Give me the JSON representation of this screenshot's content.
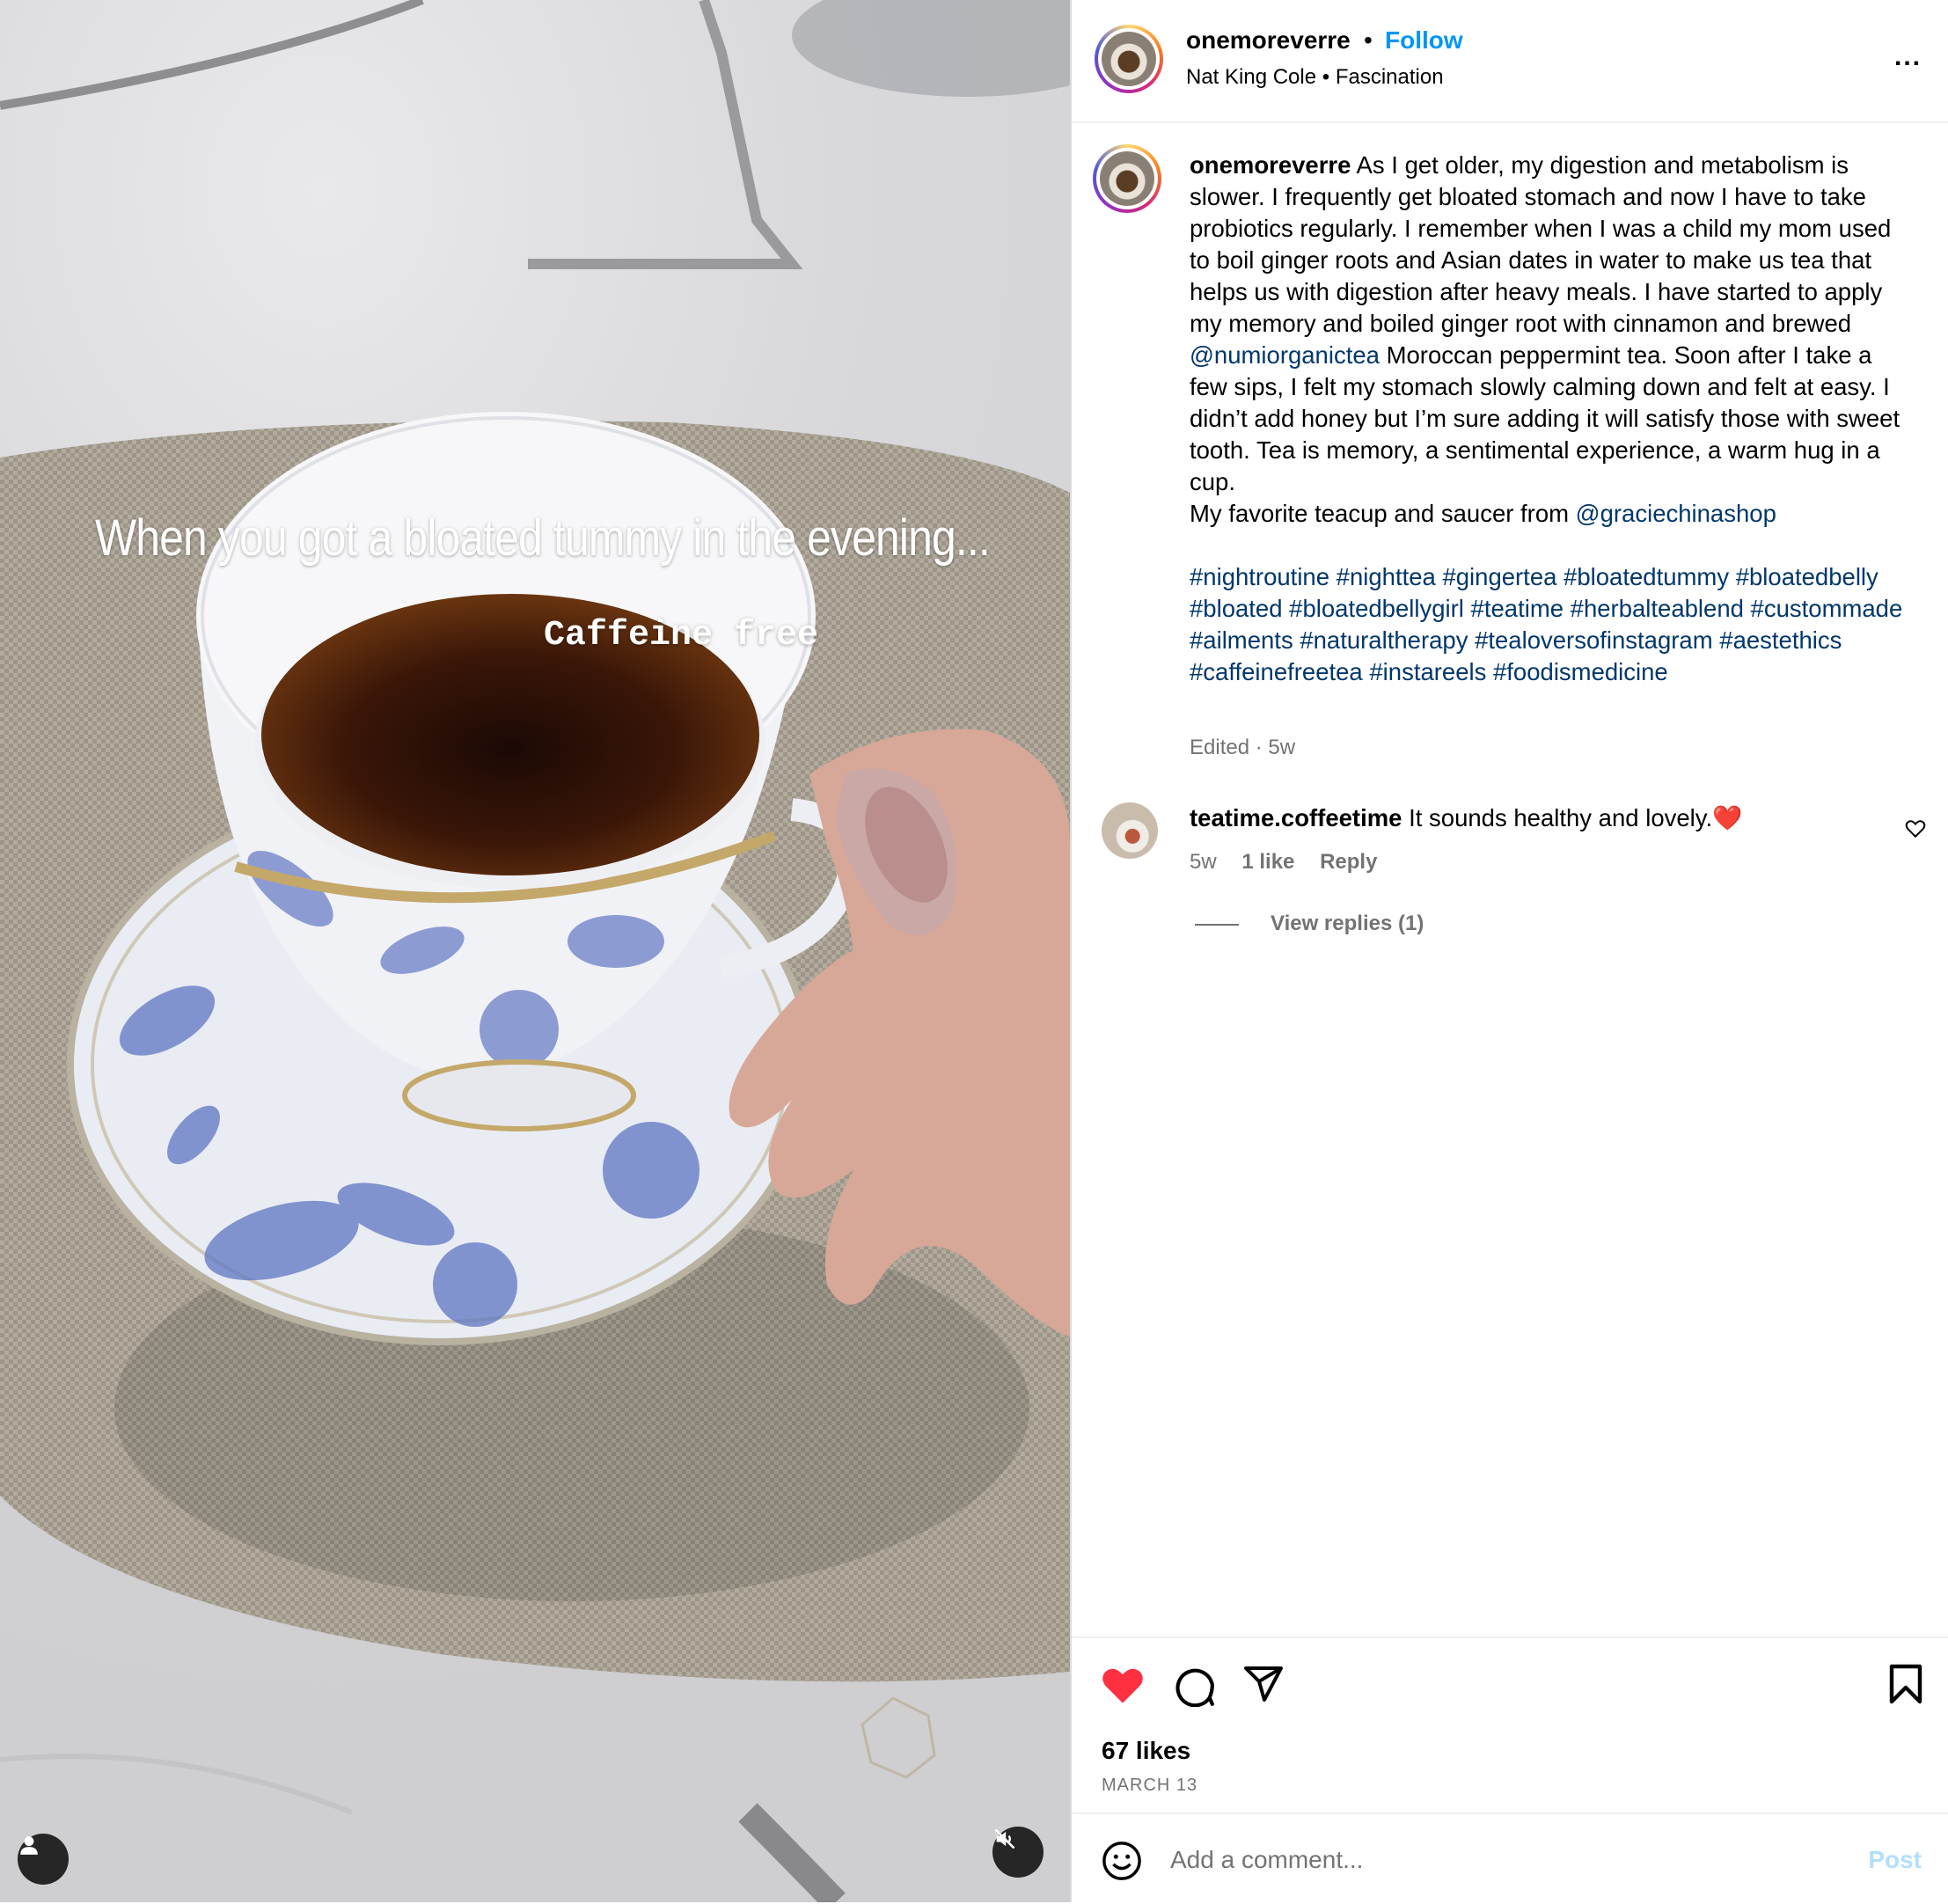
{
  "media": {
    "overlay_title": "When you got a bloated tummy in the evening...",
    "overlay_subtitle": "Caffeine free",
    "user_icon": "user-icon",
    "mute_icon": "muted-speaker-icon"
  },
  "header": {
    "username": "onemoreverre",
    "separator": "•",
    "follow_label": "Follow",
    "music_artist": "Nat King Cole",
    "music_title": "Fascination",
    "more_label": "..."
  },
  "caption": {
    "username": "onemoreverre",
    "text_1": " As I get older, my digestion and metabolism is slower. I frequently get bloated stomach and now I have to take probiotics regularly. I remember when I was a child my mom used to boil ginger roots and Asian dates in water to make us tea that helps us with digestion after heavy meals. I have started to apply my memory and boiled ginger root with cinnamon and brewed ",
    "mention_1": "@numiorganictea",
    "text_2": " Moroccan peppermint tea. Soon after I take a few sips, I felt my stomach slowly calming down and felt at easy. I didn’t add honey but I’m sure adding it will satisfy those with sweet tooth. Tea is memory, a sentimental experience, a warm hug in a cup.",
    "text_3": "My favorite teacup and saucer from ",
    "mention_2": "@graciechinashop",
    "hashtags": "#nightroutine #nighttea #gingertea #bloatedtummy #bloatedbelly #bloated #bloatedbellygirl #teatime #herbalteablend #custommade #ailments #naturaltherapy #tealoversofinstagram #aestethics #caffeinefreetea #instareels #foodismedicine",
    "meta": "Edited · 5w"
  },
  "comment": {
    "username": "teatime.coffeetime",
    "text": " It sounds healthy and lovely.❤️",
    "time": "5w",
    "likes": "1 like",
    "reply_label": "Reply",
    "view_replies": "View replies (1)"
  },
  "actions": {
    "likes": "67 likes",
    "date": "MARCH 13",
    "liked_color": "#ff3040"
  },
  "comment_bar": {
    "placeholder": "Add a comment...",
    "post_label": "Post"
  }
}
